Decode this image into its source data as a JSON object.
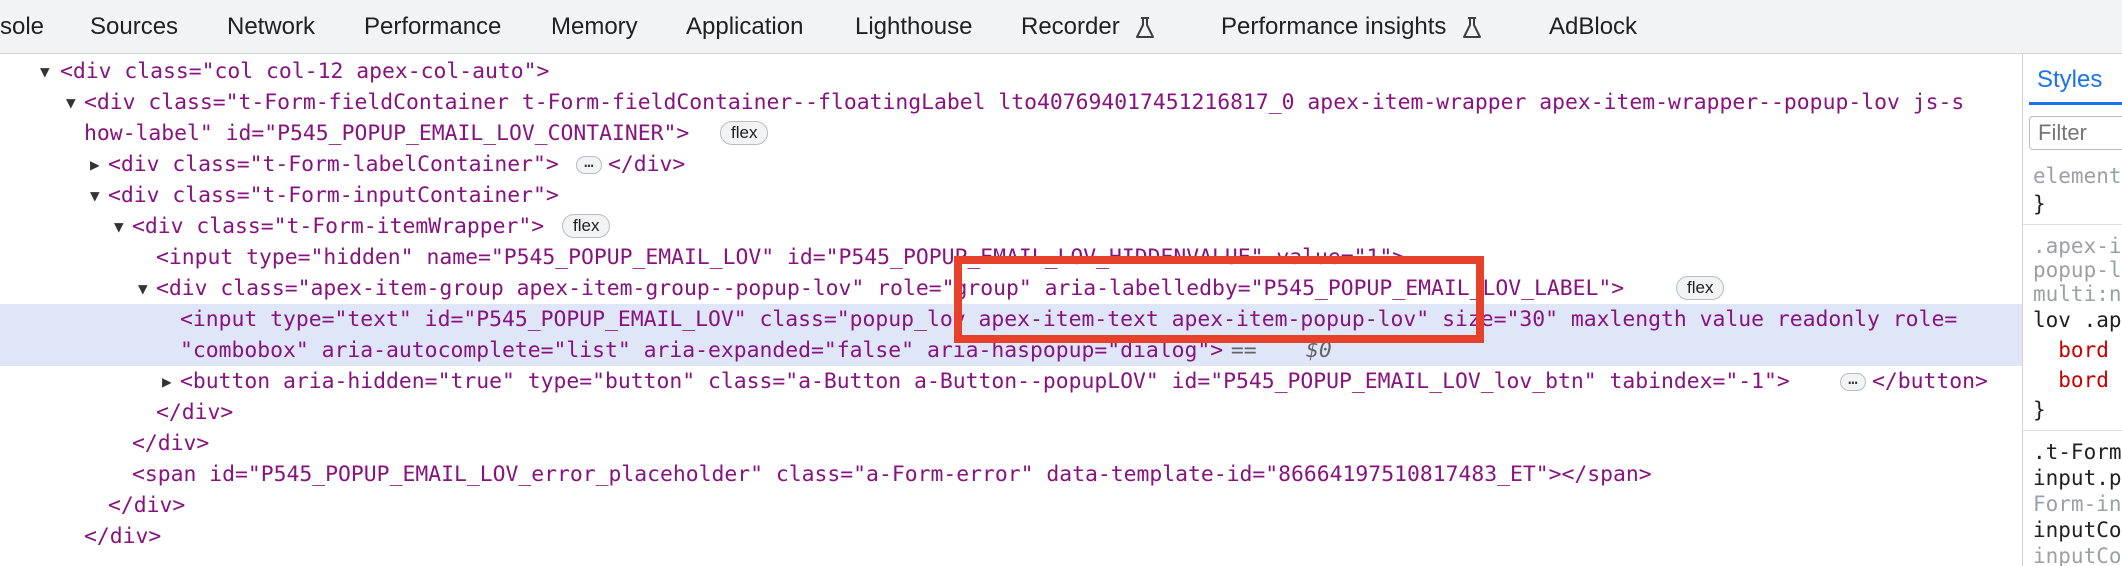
{
  "tabs": [
    {
      "label": "sole"
    },
    {
      "label": "Sources"
    },
    {
      "label": "Network"
    },
    {
      "label": "Performance"
    },
    {
      "label": "Memory"
    },
    {
      "label": "Application"
    },
    {
      "label": "Lighthouse"
    },
    {
      "label": "Recorder"
    },
    {
      "label": "Performance insights"
    },
    {
      "label": "AdBlock"
    }
  ],
  "dom": {
    "l1_tag": "<div class=\"col col-12 apex-col-auto\">",
    "l2a": "<div class=\"t-Form-fieldContainer t-Form-fieldContainer--floatingLabel lto407694017451216817_0 apex-item-wrapper apex-item-wrapper--popup-lov js-s",
    "l2b": "how-label\" id=\"P545_POPUP_EMAIL_LOV_CONTAINER\">",
    "l3_open": "<div class=\"t-Form-labelContainer\">",
    "l3_close": "</div>",
    "l4": "<div class=\"t-Form-inputContainer\">",
    "l5": "<div class=\"t-Form-itemWrapper\">",
    "l6": "<input type=\"hidden\" name=\"P545_POPUP_EMAIL_LOV\" id=\"P545_POPUP_EMAIL_LOV_HIDDENVALUE\" value=\"1\">",
    "l7": "<div class=\"apex-item-group apex-item-group--popup-lov\" role=\"group\" aria-labelledby=\"P545_POPUP_EMAIL_LOV_LABEL\">",
    "l8a": "<input type=\"text\" id=\"P545_POPUP_EMAIL_LOV\" class=\"popup_lov apex-item-text apex-item-popup-lov\" size=\"30\" maxlength value readonly role=",
    "l8b": "\"combobox\" aria-autocomplete=\"list\" aria-expanded=\"false\" aria-haspopup=\"dialog\">",
    "l8_eq": " == ",
    "l8_dollar": "$0",
    "l9_open": "<button aria-hidden=\"true\" type=\"button\" class=\"a-Button a-Button--popupLOV\" id=\"P545_POPUP_EMAIL_LOV_lov_btn\" tabindex=\"-1\">",
    "l9_close": "</button>",
    "l10": "</div>",
    "l11": "</div>",
    "l12": "<span id=\"P545_POPUP_EMAIL_LOV_error_placeholder\" class=\"a-Form-error\" data-template-id=\"86664197510817483_ET\"></span>",
    "l13": "</div>",
    "l14": "</div>",
    "badge_flex": "flex"
  },
  "styles": {
    "tab_label": "Styles",
    "filter_placeholder": "Filter",
    "lines": [
      "element",
      "}",
      ".apex-i",
      "popup-l",
      "multi:n",
      "lov .ap",
      "  bord",
      "  bord",
      "}",
      ".t-Form",
      "input.p",
      "Form-in",
      "inputCo",
      "inputCo"
    ]
  },
  "colors": {
    "highlight_box": "#e8412b",
    "selected_row": "#dfe6f8"
  }
}
